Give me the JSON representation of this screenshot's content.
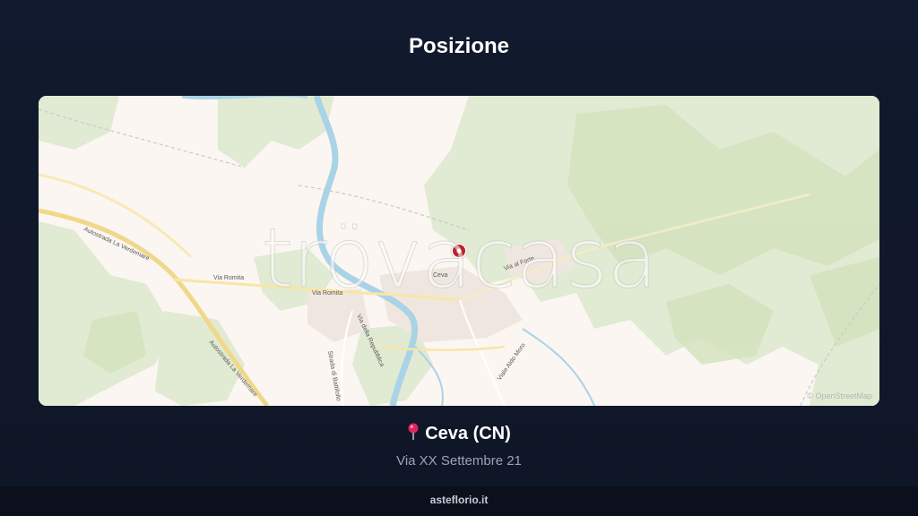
{
  "header": {
    "title": "Posizione"
  },
  "map": {
    "watermark": "trövacasa",
    "attribution": "© OpenStreetMap",
    "labels": {
      "city": "Ceva",
      "via_romita_1": "Via Romita",
      "via_romita_2": "Via Romita",
      "autostrada_1": "Autostrada La Verdemare",
      "autostrada_2": "Autostrada La Verdemare",
      "via_al_forte": "Via al Forte",
      "via_repubblica": "Via della Repubblica",
      "strada_battifollo": "Strada di Battifollo",
      "viale_moro": "Viale Aldo Moro"
    },
    "marker_icon": "map-marker-icon"
  },
  "location": {
    "pin_icon": "pin-icon",
    "city": "Ceva (CN)",
    "address": "Via XX Settembre 21"
  },
  "footer": {
    "brand": "asteflorio.it"
  },
  "colors": {
    "background": "#111a2e",
    "marker": "#c0202a",
    "river": "#a9d3e6",
    "forest": "#dfe9cf",
    "highway": "#f3dc92"
  }
}
